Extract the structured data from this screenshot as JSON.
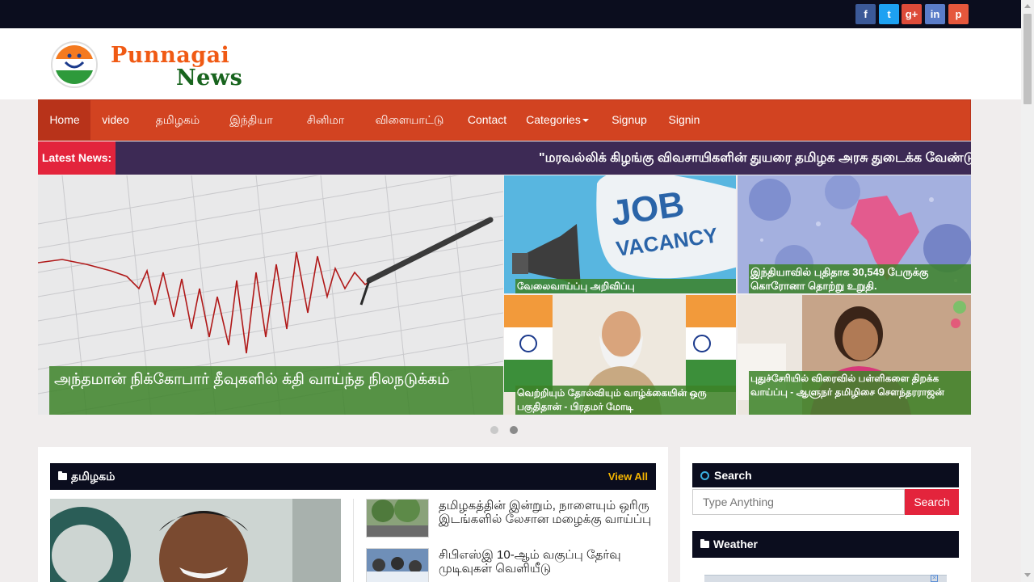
{
  "social": [
    {
      "icon": "facebook-icon",
      "glyph": "f",
      "color": "#3b5998"
    },
    {
      "icon": "twitter-icon",
      "glyph": "t",
      "color": "#1da1f2"
    },
    {
      "icon": "google-plus-icon",
      "glyph": "g+",
      "color": "#dd4b39"
    },
    {
      "icon": "linkedin-icon",
      "glyph": "in",
      "color": "#5a7cc8"
    },
    {
      "icon": "pinterest-icon",
      "glyph": "p",
      "color": "#e5573c"
    }
  ],
  "logo": {
    "word1": "Punnagai",
    "word2": "News"
  },
  "nav": {
    "home": "Home",
    "video": "video",
    "tamilnadu": "தமிழகம்",
    "india": "இந்தியா",
    "cinema": "சினிமா",
    "sports": "விளையாட்டு",
    "contact": "Contact",
    "categories": "Categories",
    "signup": "Signup",
    "signin": "Signin"
  },
  "ticker": {
    "label": "Latest News:",
    "text": "\"மரவல்லிக் கிழங்கு விவசாயிகளின் துயரை தமிழக அரசு துடைக்க வேண்டும்\""
  },
  "slider": {
    "main_caption": "அந்தமான் நிக்கோபார் தீவுகளில் க்தி வாய்ந்த நிலநடுக்கம்",
    "job_image_text_1": "JOB",
    "job_image_text_2": "VACANCY",
    "job_caption": "வேலைவாய்ப்பு அறிவிப்பு",
    "covid_caption": "இந்தியாவில் புதிதாக 30,549 பேருக்கு கொரோனா தொற்று உறுதி.",
    "modi_caption": "வெற்றியும் தோல்வியும் வாழ்க்கையின் ஒரு பகுதிதான் - பிரதமர் மோடி",
    "governor_caption": "புதுச்சேரியில் விரைவில் பள்ளிகளை திறக்க வாய்ப்பு - ஆளுநர் தமிழிசை சௌந்தரராஜன்"
  },
  "tamilnadu_section": {
    "title": "தமிழகம்",
    "view_all": "View All",
    "items": [
      "தமிழகத்தின் இன்றும், நாளையும் ஒரிரு இடங்களில் லேசான மழைக்கு வாய்ப்பு",
      "சிபிஎஸ்இ 10-ஆம் வகுப்பு தேர்வு முடிவுகள் வெளியீடு"
    ]
  },
  "search": {
    "title": "Search",
    "placeholder": "Type Anything",
    "button": "Search"
  },
  "weather": {
    "title": "Weather"
  }
}
